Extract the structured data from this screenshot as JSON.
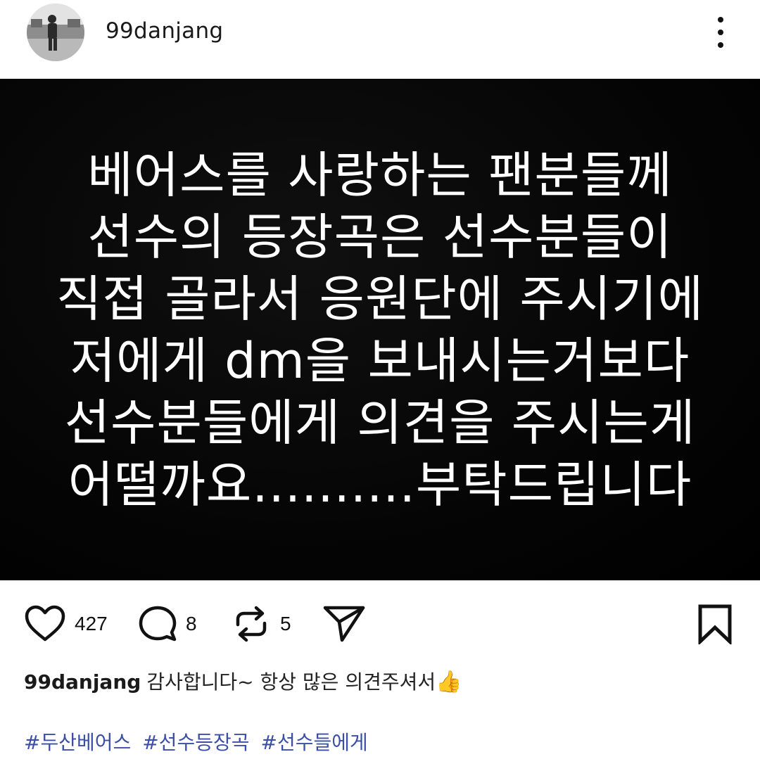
{
  "post": {
    "username": "99danjang",
    "image_text_lines": [
      "베어스를 사랑하는 팬분들께",
      "선수의 등장곡은 선수분들이",
      "직접 골라서 응원단에 주시기에",
      "저에게 dm을 보내시는거보다",
      "선수분들에게 의견을 주시는게",
      "어떨까요..........부탁드립니다"
    ],
    "likes": "427",
    "comments": "8",
    "reposts": "5",
    "caption_user": "99danjang",
    "caption_text": "감사합니다~ 항상 많은 의견주셔서",
    "caption_emoji": "👍",
    "hashtags": [
      "#두산베어스",
      "#선수등장곡",
      "#선수들에게"
    ]
  },
  "icons": {
    "more": "more-vertical-icon",
    "like": "heart-icon",
    "comment": "comment-bubble-icon",
    "repost": "repost-arrows-icon",
    "share": "paper-plane-icon",
    "save": "bookmark-icon"
  },
  "colors": {
    "image_bg": "#030303",
    "hashtag": "#3b4fa6",
    "icon": "#111111"
  }
}
